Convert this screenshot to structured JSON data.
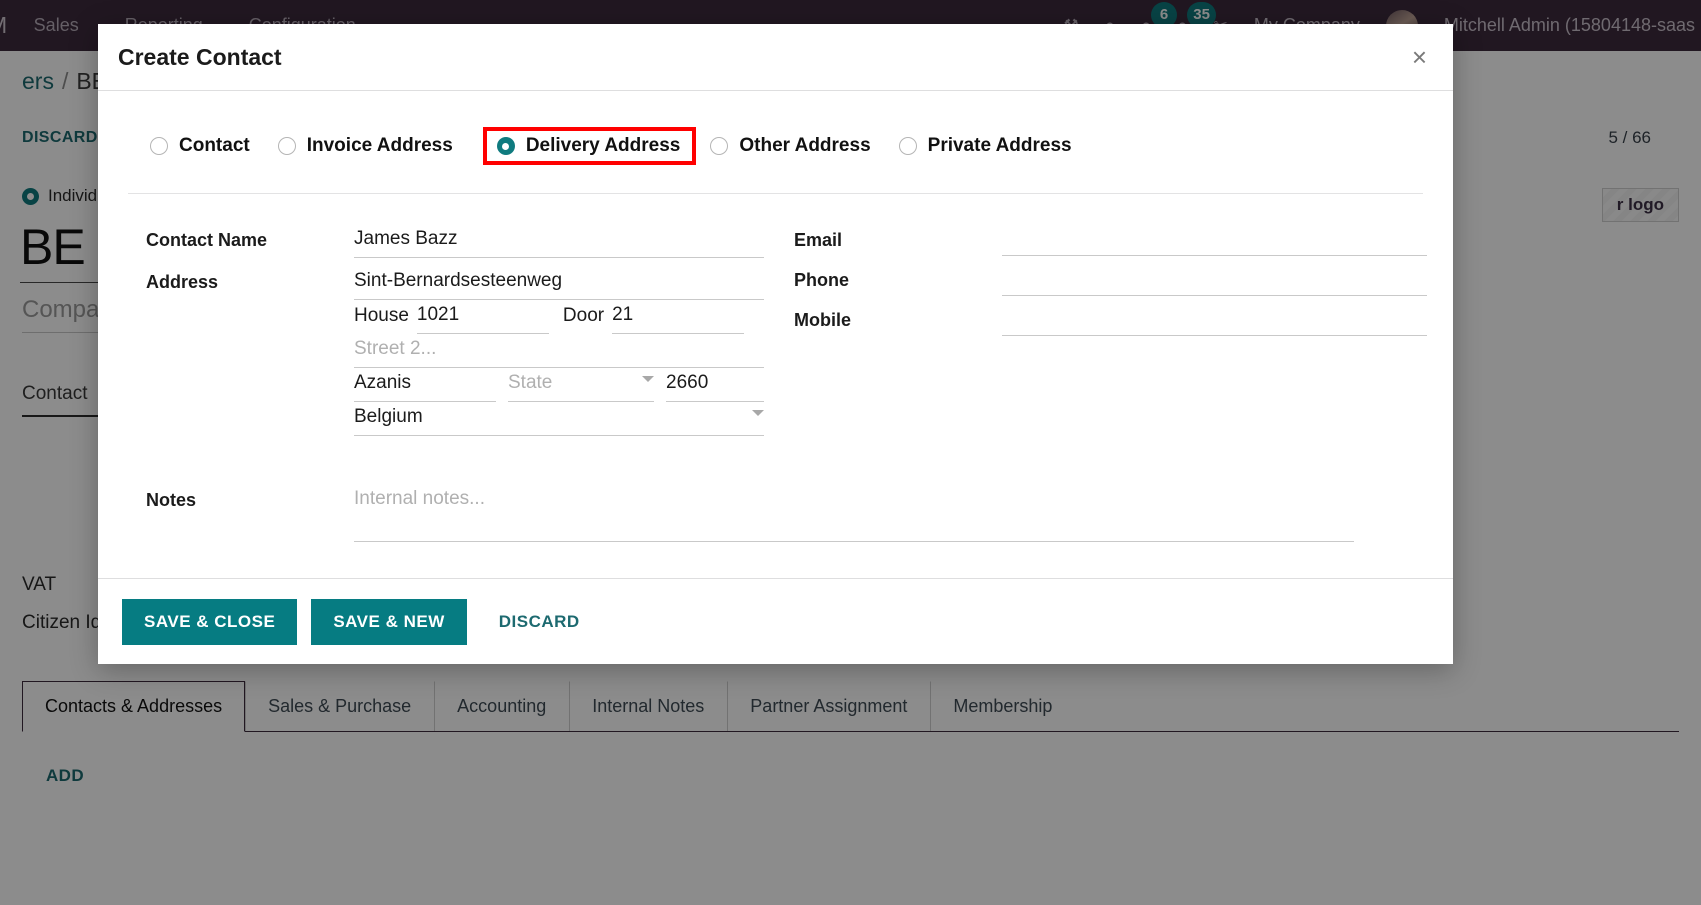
{
  "navbar": {
    "brand": "M",
    "menu": [
      "Sales",
      "Reporting",
      "Configuration"
    ],
    "icons": {
      "bug": "bug-icon",
      "pin": "pin-icon",
      "messages": "message-icon",
      "activities": "clock-icon",
      "shortcut": "scissors-icon"
    },
    "message_count": "6",
    "activity_count": "35",
    "company": "My Company",
    "user": "Mitchell Admin (15804148-saas"
  },
  "breadcrumb": {
    "parent": "ers",
    "separator": "/",
    "current": "BE C"
  },
  "controls": {
    "discard": "DISCARD",
    "pager": "5 / 66"
  },
  "record": {
    "type_label": "Individ",
    "name": "BE C",
    "company_placeholder": "Company",
    "contact_label": "Contact",
    "vat_label": "VAT",
    "citizen_label": "Citizen Ide",
    "logo_button": "r logo"
  },
  "tabs": [
    {
      "label": "Contacts & Addresses",
      "active": true
    },
    {
      "label": "Sales & Purchase",
      "active": false
    },
    {
      "label": "Accounting",
      "active": false
    },
    {
      "label": "Internal Notes",
      "active": false
    },
    {
      "label": "Partner Assignment",
      "active": false
    },
    {
      "label": "Membership",
      "active": false
    }
  ],
  "add_link": "ADD",
  "modal": {
    "title": "Create Contact",
    "close_icon": "close-icon",
    "address_types": [
      {
        "label": "Contact",
        "selected": false,
        "highlighted": false
      },
      {
        "label": "Invoice Address",
        "selected": false,
        "highlighted": false
      },
      {
        "label": "Delivery Address",
        "selected": true,
        "highlighted": true
      },
      {
        "label": "Other Address",
        "selected": false,
        "highlighted": false
      },
      {
        "label": "Private Address",
        "selected": false,
        "highlighted": false
      }
    ],
    "fields": {
      "contact_name_label": "Contact Name",
      "contact_name_value": "James Bazz",
      "address_label": "Address",
      "street_value": "Sint-Bernardsesteenweg",
      "house_label": "House",
      "house_value": "1021",
      "door_label": "Door",
      "door_value": "21",
      "street2_placeholder": "Street 2...",
      "city_value": "Azanis",
      "state_placeholder": "State",
      "zip_value": "2660",
      "country_value": "Belgium",
      "notes_label": "Notes",
      "notes_placeholder": "Internal notes...",
      "email_label": "Email",
      "email_value": "",
      "phone_label": "Phone",
      "phone_value": "",
      "mobile_label": "Mobile",
      "mobile_value": ""
    },
    "footer": {
      "save_close": "SAVE & CLOSE",
      "save_new": "SAVE & NEW",
      "discard": "DISCARD"
    }
  },
  "colors": {
    "accent_teal": "#067c82",
    "navbar": "#3c2a3d",
    "highlight_red": "#ff0000"
  }
}
